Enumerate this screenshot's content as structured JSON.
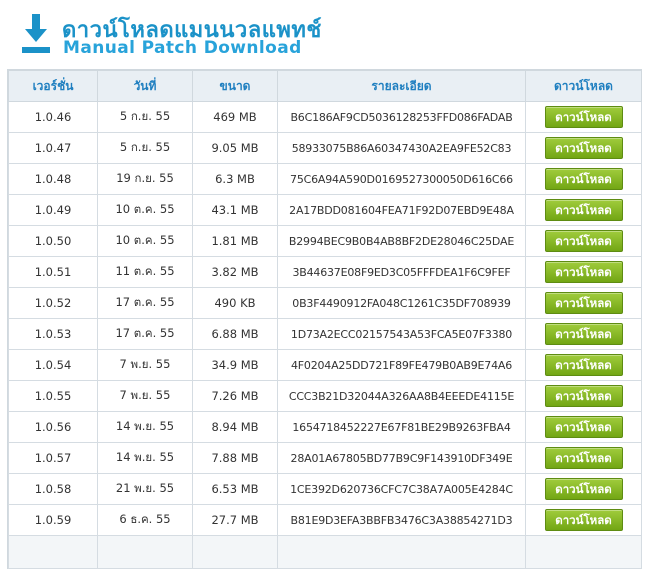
{
  "header": {
    "title_th": "ดาวน์โหลดแมนนวลแพทช์",
    "title_en": "Manual Patch Download",
    "icon": "download-arrow-icon",
    "accent": "#1b92c8"
  },
  "table": {
    "columns": [
      "เวอร์ชั่น",
      "วันที่",
      "ขนาด",
      "รายละเอียด",
      "ดาวน์โหลด"
    ],
    "button_label": "ดาวน์โหลด",
    "button_color": "#7fb320",
    "rows": [
      {
        "version": "1.0.46",
        "date": "5 ก.ย. 55",
        "size": "469 MB",
        "hash": "B6C186AF9CD5036128253FFD086FADAB"
      },
      {
        "version": "1.0.47",
        "date": "5 ก.ย. 55",
        "size": "9.05 MB",
        "hash": "58933075B86A60347430A2EA9FE52C83"
      },
      {
        "version": "1.0.48",
        "date": "19 ก.ย. 55",
        "size": "6.3 MB",
        "hash": "75C6A94A590D016952730005 0D616C66"
      },
      {
        "version": "1.0.49",
        "date": "10 ต.ค. 55",
        "size": "43.1 MB",
        "hash": "2A17BDD081604FEA71F92D07EBD9E48A"
      },
      {
        "version": "1.0.50",
        "date": "10 ต.ค. 55",
        "size": "1.81 MB",
        "hash": "B2994BEC9B0B4AB8BF2DE28046C25DAE"
      },
      {
        "version": "1.0.51",
        "date": "11 ต.ค. 55",
        "size": "3.82 MB",
        "hash": "3B44637E08F9ED3C05FFFDEA1F6C9FEF"
      },
      {
        "version": "1.0.52",
        "date": "17 ต.ค. 55",
        "size": "490 KB",
        "hash": "0B3F4490912FA048C1261C35DF708939"
      },
      {
        "version": "1.0.53",
        "date": "17 ต.ค. 55",
        "size": "6.88 MB",
        "hash": "1D73A2ECC02157543A53FCA5E07F3380"
      },
      {
        "version": "1.0.54",
        "date": "7 พ.ย. 55",
        "size": "34.9 MB",
        "hash": "4F0204A25DD721F89FE479B0AB9E74A6"
      },
      {
        "version": "1.0.55",
        "date": "7 พ.ย. 55",
        "size": "7.26 MB",
        "hash": "CCC3B21D32044A326AA8B4EEEDE4115E"
      },
      {
        "version": "1.0.56",
        "date": "14 พ.ย. 55",
        "size": "8.94 MB",
        "hash": "1654718452227E67F81BE29B9263FBA4"
      },
      {
        "version": "1.0.57",
        "date": "14 พ.ย. 55",
        "size": "7.88 MB",
        "hash": "28A01A67805BD77B9C9F143910DF349E"
      },
      {
        "version": "1.0.58",
        "date": "21 พ.ย. 55",
        "size": "6.53 MB",
        "hash": "1CE392D620736CFC7C38A7A005E4284C"
      },
      {
        "version": "1.0.59",
        "date": "6 ธ.ค. 55",
        "size": "27.7 MB",
        "hash": "B81E9D3EFA3BBFB3476C3A38854271D3"
      }
    ]
  }
}
